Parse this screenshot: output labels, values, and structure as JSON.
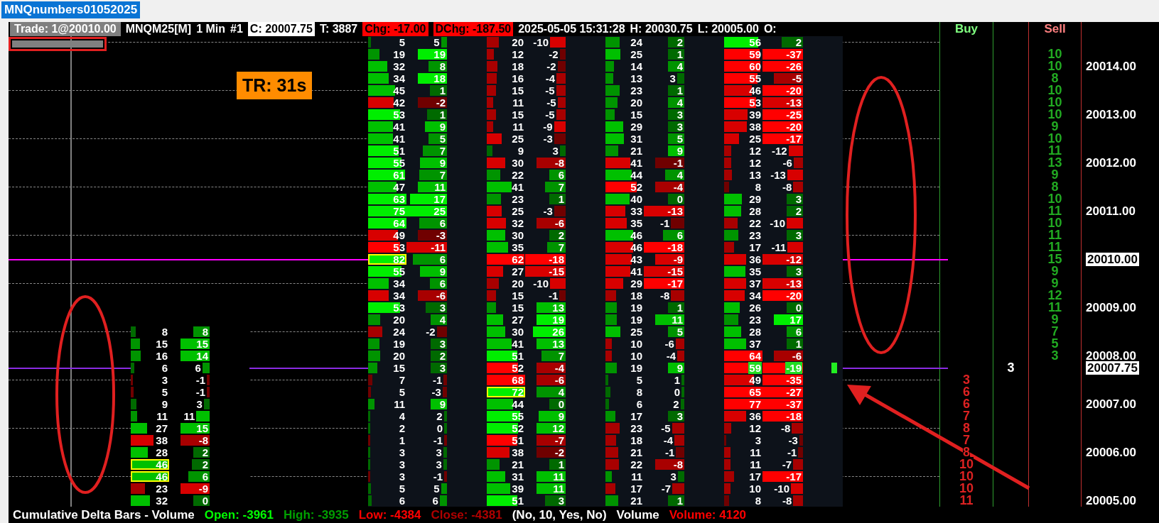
{
  "window": {
    "title": "MNQnumbers01052025"
  },
  "header": [
    {
      "text": "Trade: 1@20010.00",
      "kind": "gray"
    },
    {
      "text": "MNQM25[M]",
      "kind": "plain"
    },
    {
      "text": "1 Min",
      "kind": "plain"
    },
    {
      "text": "#1",
      "kind": "plain"
    },
    {
      "text": "C: 20007.75",
      "kind": "white"
    },
    {
      "text": "T: 3887",
      "kind": "plain"
    },
    {
      "text": "Chg: -17.00",
      "kind": "red"
    },
    {
      "text": "DChg: -187.50",
      "kind": "red"
    },
    {
      "text": "2025-05-05 15:31:28",
      "kind": "plain"
    },
    {
      "text": "H: 20030.75",
      "kind": "plain"
    },
    {
      "text": "L: 20005.00",
      "kind": "plain"
    },
    {
      "text": "O:",
      "kind": "plain"
    }
  ],
  "timer": "TR: 31s",
  "footprint": {
    "columns": [
      {
        "rows": [
          {
            "volume": "8",
            "delta": "8",
            "outlined": false
          },
          {
            "volume": "15",
            "delta": "15",
            "outlined": false
          },
          {
            "volume": "16",
            "delta": "14",
            "outlined": false
          },
          {
            "volume": "6",
            "delta": "6",
            "outlined": false
          },
          {
            "volume": "3",
            "delta": "-1",
            "outlined": false
          },
          {
            "volume": "5",
            "delta": "-1",
            "outlined": false
          },
          {
            "volume": "9",
            "delta": "3",
            "outlined": false
          },
          {
            "volume": "11",
            "delta": "11",
            "outlined": false
          },
          {
            "volume": "27",
            "delta": "15",
            "outlined": false
          },
          {
            "volume": "38",
            "delta": "-8",
            "outlined": false
          },
          {
            "volume": "28",
            "delta": "2",
            "outlined": false
          },
          {
            "volume": "46",
            "delta": "2",
            "outlined": true
          },
          {
            "volume": "46",
            "delta": "6",
            "outlined": true
          },
          {
            "volume": "23",
            "delta": "-9",
            "outlined": false
          },
          {
            "volume": "32",
            "delta": "0",
            "outlined": false
          }
        ]
      },
      {
        "rows": [
          {
            "volume": "5",
            "delta": "5",
            "outlined": false
          },
          {
            "volume": "19",
            "delta": "19",
            "outlined": false
          },
          {
            "volume": "32",
            "delta": "8",
            "outlined": false
          },
          {
            "volume": "34",
            "delta": "18",
            "outlined": false
          },
          {
            "volume": "45",
            "delta": "1",
            "outlined": false
          },
          {
            "volume": "42",
            "delta": "-2",
            "outlined": false
          },
          {
            "volume": "53",
            "delta": "1",
            "outlined": false
          },
          {
            "volume": "41",
            "delta": "9",
            "outlined": false
          },
          {
            "volume": "41",
            "delta": "5",
            "outlined": false
          },
          {
            "volume": "51",
            "delta": "7",
            "outlined": false
          },
          {
            "volume": "55",
            "delta": "9",
            "outlined": false
          },
          {
            "volume": "61",
            "delta": "7",
            "outlined": false
          },
          {
            "volume": "47",
            "delta": "11",
            "outlined": false
          },
          {
            "volume": "63",
            "delta": "17",
            "outlined": false
          },
          {
            "volume": "75",
            "delta": "25",
            "outlined": false
          },
          {
            "volume": "64",
            "delta": "6",
            "outlined": false
          },
          {
            "volume": "49",
            "delta": "-3",
            "outlined": false
          },
          {
            "volume": "53",
            "delta": "-11",
            "outlined": false
          },
          {
            "volume": "82",
            "delta": "6",
            "outlined": true
          },
          {
            "volume": "55",
            "delta": "9",
            "outlined": false
          },
          {
            "volume": "34",
            "delta": "6",
            "outlined": false
          },
          {
            "volume": "34",
            "delta": "-6",
            "outlined": false
          },
          {
            "volume": "53",
            "delta": "3",
            "outlined": false
          },
          {
            "volume": "20",
            "delta": "4",
            "outlined": false
          },
          {
            "volume": "24",
            "delta": "-2",
            "outlined": false
          },
          {
            "volume": "19",
            "delta": "3",
            "outlined": false
          },
          {
            "volume": "20",
            "delta": "2",
            "outlined": false
          },
          {
            "volume": "15",
            "delta": "3",
            "outlined": false
          },
          {
            "volume": "7",
            "delta": "-1",
            "outlined": false
          },
          {
            "volume": "5",
            "delta": "-3",
            "outlined": false
          },
          {
            "volume": "11",
            "delta": "9",
            "outlined": false
          },
          {
            "volume": "4",
            "delta": "2",
            "outlined": false
          },
          {
            "volume": "2",
            "delta": "0",
            "outlined": false
          },
          {
            "volume": "1",
            "delta": "-1",
            "outlined": false
          },
          {
            "volume": "3",
            "delta": "3",
            "outlined": false
          },
          {
            "volume": "3",
            "delta": "3",
            "outlined": false
          },
          {
            "volume": "3",
            "delta": "-1",
            "outlined": false
          },
          {
            "volume": "5",
            "delta": "5",
            "outlined": false
          },
          {
            "volume": "6",
            "delta": "6",
            "outlined": false
          }
        ]
      },
      {
        "rows": [
          {
            "volume": "20",
            "delta": "-10",
            "outlined": false
          },
          {
            "volume": "12",
            "delta": "-2",
            "outlined": false
          },
          {
            "volume": "18",
            "delta": "-2",
            "outlined": false
          },
          {
            "volume": "16",
            "delta": "-4",
            "outlined": false
          },
          {
            "volume": "15",
            "delta": "-5",
            "outlined": false
          },
          {
            "volume": "11",
            "delta": "-5",
            "outlined": false
          },
          {
            "volume": "15",
            "delta": "-5",
            "outlined": false
          },
          {
            "volume": "11",
            "delta": "-9",
            "outlined": false
          },
          {
            "volume": "25",
            "delta": "-3",
            "outlined": false
          },
          {
            "volume": "9",
            "delta": "3",
            "outlined": false
          },
          {
            "volume": "30",
            "delta": "-8",
            "outlined": false
          },
          {
            "volume": "22",
            "delta": "6",
            "outlined": false
          },
          {
            "volume": "41",
            "delta": "7",
            "outlined": false
          },
          {
            "volume": "23",
            "delta": "1",
            "outlined": false
          },
          {
            "volume": "25",
            "delta": "-3",
            "outlined": false
          },
          {
            "volume": "32",
            "delta": "-6",
            "outlined": false
          },
          {
            "volume": "30",
            "delta": "2",
            "outlined": false
          },
          {
            "volume": "35",
            "delta": "7",
            "outlined": false
          },
          {
            "volume": "62",
            "delta": "-18",
            "outlined": false
          },
          {
            "volume": "27",
            "delta": "-15",
            "outlined": false
          },
          {
            "volume": "20",
            "delta": "-10",
            "outlined": false
          },
          {
            "volume": "15",
            "delta": "-1",
            "outlined": false
          },
          {
            "volume": "15",
            "delta": "13",
            "outlined": false
          },
          {
            "volume": "27",
            "delta": "19",
            "outlined": false
          },
          {
            "volume": "30",
            "delta": "26",
            "outlined": false
          },
          {
            "volume": "41",
            "delta": "13",
            "outlined": false
          },
          {
            "volume": "51",
            "delta": "7",
            "outlined": false
          },
          {
            "volume": "52",
            "delta": "-4",
            "outlined": false
          },
          {
            "volume": "68",
            "delta": "-6",
            "outlined": false
          },
          {
            "volume": "72",
            "delta": "4",
            "outlined": true
          },
          {
            "volume": "44",
            "delta": "0",
            "outlined": false
          },
          {
            "volume": "55",
            "delta": "9",
            "outlined": false
          },
          {
            "volume": "52",
            "delta": "12",
            "outlined": false
          },
          {
            "volume": "51",
            "delta": "-7",
            "outlined": false
          },
          {
            "volume": "38",
            "delta": "-2",
            "outlined": false
          },
          {
            "volume": "21",
            "delta": "1",
            "outlined": false
          },
          {
            "volume": "31",
            "delta": "11",
            "outlined": false
          },
          {
            "volume": "39",
            "delta": "11",
            "outlined": false
          },
          {
            "volume": "51",
            "delta": "3",
            "outlined": false
          }
        ]
      },
      {
        "rows": [
          {
            "volume": "24",
            "delta": "2",
            "outlined": false
          },
          {
            "volume": "25",
            "delta": "1",
            "outlined": false
          },
          {
            "volume": "14",
            "delta": "4",
            "outlined": false
          },
          {
            "volume": "13",
            "delta": "3",
            "outlined": false
          },
          {
            "volume": "23",
            "delta": "1",
            "outlined": false
          },
          {
            "volume": "20",
            "delta": "4",
            "outlined": false
          },
          {
            "volume": "15",
            "delta": "3",
            "outlined": false
          },
          {
            "volume": "29",
            "delta": "3",
            "outlined": false
          },
          {
            "volume": "31",
            "delta": "5",
            "outlined": false
          },
          {
            "volume": "21",
            "delta": "9",
            "outlined": false
          },
          {
            "volume": "41",
            "delta": "-1",
            "outlined": false
          },
          {
            "volume": "44",
            "delta": "4",
            "outlined": false
          },
          {
            "volume": "52",
            "delta": "-4",
            "outlined": false
          },
          {
            "volume": "40",
            "delta": "0",
            "outlined": false
          },
          {
            "volume": "33",
            "delta": "-13",
            "outlined": false
          },
          {
            "volume": "35",
            "delta": "-1",
            "outlined": false
          },
          {
            "volume": "46",
            "delta": "6",
            "outlined": false
          },
          {
            "volume": "46",
            "delta": "-18",
            "outlined": false
          },
          {
            "volume": "43",
            "delta": "-9",
            "outlined": false
          },
          {
            "volume": "41",
            "delta": "-15",
            "outlined": false
          },
          {
            "volume": "29",
            "delta": "-17",
            "outlined": false
          },
          {
            "volume": "18",
            "delta": "-8",
            "outlined": false
          },
          {
            "volume": "19",
            "delta": "1",
            "outlined": false
          },
          {
            "volume": "19",
            "delta": "11",
            "outlined": false
          },
          {
            "volume": "25",
            "delta": "5",
            "outlined": false
          },
          {
            "volume": "10",
            "delta": "-6",
            "outlined": false
          },
          {
            "volume": "10",
            "delta": "-4",
            "outlined": false
          },
          {
            "volume": "19",
            "delta": "9",
            "outlined": false
          },
          {
            "volume": "5",
            "delta": "1",
            "outlined": false
          },
          {
            "volume": "8",
            "delta": "0",
            "outlined": false
          },
          {
            "volume": "6",
            "delta": "2",
            "outlined": false
          },
          {
            "volume": "17",
            "delta": "3",
            "outlined": false
          },
          {
            "volume": "23",
            "delta": "-5",
            "outlined": false
          },
          {
            "volume": "18",
            "delta": "-4",
            "outlined": false
          },
          {
            "volume": "21",
            "delta": "-1",
            "outlined": false
          },
          {
            "volume": "22",
            "delta": "-8",
            "outlined": false
          },
          {
            "volume": "11",
            "delta": "3",
            "outlined": false
          },
          {
            "volume": "17",
            "delta": "-7",
            "outlined": false
          },
          {
            "volume": "21",
            "delta": "1",
            "outlined": false
          }
        ]
      },
      {
        "rows": [
          {
            "volume": "56",
            "delta": "2",
            "outlined": false,
            "current": false
          },
          {
            "volume": "59",
            "delta": "-37",
            "outlined": false,
            "current": false
          },
          {
            "volume": "60",
            "delta": "-26",
            "outlined": false,
            "current": false
          },
          {
            "volume": "55",
            "delta": "-5",
            "outlined": false,
            "current": false
          },
          {
            "volume": "46",
            "delta": "-20",
            "outlined": false,
            "current": false
          },
          {
            "volume": "53",
            "delta": "-13",
            "outlined": false,
            "current": false
          },
          {
            "volume": "39",
            "delta": "-25",
            "outlined": false,
            "current": false
          },
          {
            "volume": "38",
            "delta": "-20",
            "outlined": false,
            "current": false
          },
          {
            "volume": "25",
            "delta": "-17",
            "outlined": false,
            "current": false
          },
          {
            "volume": "12",
            "delta": "-12",
            "outlined": false,
            "current": false
          },
          {
            "volume": "12",
            "delta": "-6",
            "outlined": false,
            "current": false
          },
          {
            "volume": "13",
            "delta": "-13",
            "outlined": false,
            "current": false
          },
          {
            "volume": "8",
            "delta": "-8",
            "outlined": false,
            "current": false
          },
          {
            "volume": "29",
            "delta": "3",
            "outlined": false,
            "current": false
          },
          {
            "volume": "28",
            "delta": "2",
            "outlined": false,
            "current": false
          },
          {
            "volume": "22",
            "delta": "-10",
            "outlined": false,
            "current": false
          },
          {
            "volume": "23",
            "delta": "3",
            "outlined": false,
            "current": false
          },
          {
            "volume": "17",
            "delta": "-11",
            "outlined": false,
            "current": false
          },
          {
            "volume": "36",
            "delta": "-12",
            "outlined": false,
            "current": false
          },
          {
            "volume": "35",
            "delta": "3",
            "outlined": false,
            "current": false
          },
          {
            "volume": "37",
            "delta": "-13",
            "outlined": false,
            "current": false
          },
          {
            "volume": "34",
            "delta": "-20",
            "outlined": false,
            "current": false
          },
          {
            "volume": "26",
            "delta": "0",
            "outlined": false,
            "current": false
          },
          {
            "volume": "23",
            "delta": "17",
            "outlined": false,
            "current": false
          },
          {
            "volume": "28",
            "delta": "6",
            "outlined": false,
            "current": false
          },
          {
            "volume": "37",
            "delta": "1",
            "outlined": false,
            "current": false
          },
          {
            "volume": "64",
            "delta": "-6",
            "outlined": false,
            "current": false
          },
          {
            "volume": "59",
            "delta": "-19",
            "outlined": false,
            "current": true
          },
          {
            "volume": "49",
            "delta": "-35",
            "outlined": false,
            "current": false
          },
          {
            "volume": "65",
            "delta": "-27",
            "outlined": false,
            "current": false
          },
          {
            "volume": "77",
            "delta": "-37",
            "outlined": false,
            "current": false
          },
          {
            "volume": "36",
            "delta": "-18",
            "outlined": false,
            "current": false
          },
          {
            "volume": "12",
            "delta": "-8",
            "outlined": false,
            "current": false
          },
          {
            "volume": "3",
            "delta": "-3",
            "outlined": false,
            "current": false
          },
          {
            "volume": "11",
            "delta": "-1",
            "outlined": false,
            "current": false
          },
          {
            "volume": "11",
            "delta": "-7",
            "outlined": false,
            "current": false
          },
          {
            "volume": "17",
            "delta": "-17",
            "outlined": false,
            "current": false
          },
          {
            "volume": "10",
            "delta": "-10",
            "outlined": false,
            "current": false
          },
          {
            "volume": "8",
            "delta": "-8",
            "outlined": false,
            "current": false
          }
        ]
      }
    ]
  },
  "ladder": {
    "headers": {
      "buy": "Buy",
      "sell": "Sell"
    },
    "rows": [
      {},
      {
        "sell": "10"
      },
      {
        "sell": "10",
        "price": "20014.00",
        "boxed": false
      },
      {
        "sell": "8"
      },
      {
        "sell": "10"
      },
      {
        "sell": "10"
      },
      {
        "sell": "10",
        "price": "20013.00",
        "boxed": false
      },
      {
        "sell": "9"
      },
      {
        "sell": "10"
      },
      {
        "sell": "11"
      },
      {
        "sell": "13",
        "price": "20012.00",
        "boxed": false
      },
      {
        "sell": "9"
      },
      {
        "sell": "8"
      },
      {
        "sell": "10"
      },
      {
        "sell": "11",
        "price": "20011.00",
        "boxed": false
      },
      {
        "sell": "10"
      },
      {
        "sell": "11"
      },
      {
        "sell": "11"
      },
      {
        "sell": "15",
        "price": "20010.00",
        "boxed": true,
        "color": "#ff00ff"
      },
      {
        "sell": "9"
      },
      {
        "sell": "9"
      },
      {
        "sell": "12"
      },
      {
        "sell": "11",
        "price": "20009.00",
        "boxed": false
      },
      {
        "sell": "9"
      },
      {
        "sell": "7"
      },
      {
        "sell": "5"
      },
      {
        "sell": "3",
        "price": "20008.00",
        "boxed": false
      },
      {
        "column_2": "3",
        "price": "20007.75",
        "boxed": true,
        "color": "#8a2be2"
      },
      {
        "buy": "3"
      },
      {
        "buy": "6"
      },
      {
        "buy": "6",
        "price": "20007.00",
        "boxed": false
      },
      {
        "buy": "7"
      },
      {
        "buy": "8"
      },
      {
        "buy": "7"
      },
      {
        "buy": "8",
        "price": "20006.00",
        "boxed": false
      },
      {
        "buy": "10"
      },
      {
        "buy": "10"
      },
      {
        "buy": "10"
      },
      {
        "buy": "11",
        "price": "20005.00",
        "boxed": false
      }
    ]
  },
  "status_bar": [
    {
      "text": "Cumulative Delta Bars - Volume",
      "color": "#ffffff"
    },
    {
      "text": "Open: -3961",
      "color": "#00ff00"
    },
    {
      "text": "High: -3935",
      "color": "#00a000"
    },
    {
      "text": "Low: -4384",
      "color": "#ff0000"
    },
    {
      "text": "Close: -4381",
      "color": "#b00000"
    },
    {
      "text": "(No, 10, Yes, No)",
      "color": "#ffffff"
    },
    {
      "text": "Volume",
      "color": "#ffffff"
    },
    {
      "text": "Volume: 4120",
      "color": "#ff0000"
    }
  ]
}
